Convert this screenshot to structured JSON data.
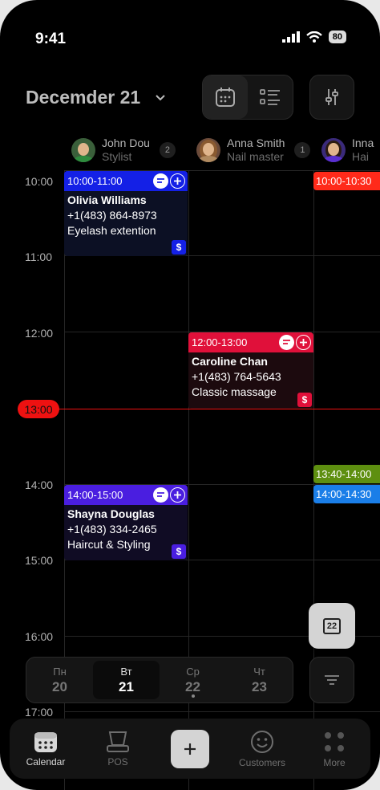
{
  "status": {
    "time": "9:41",
    "battery": "80"
  },
  "header": {
    "date": "Decemder 21"
  },
  "staff": [
    {
      "name": "John Dou",
      "role": "Stylist",
      "count": "2",
      "shirt": "#2e8b3e",
      "bg": "#3a5f3a"
    },
    {
      "name": "Anna Smith",
      "role": "Nail master",
      "count": "1",
      "shirt": "#b08a60",
      "bg": "#6a4a3a"
    },
    {
      "name": "Inna",
      "role": "Hai",
      "count": "",
      "shirt": "#5a2fd0",
      "bg": "#3a2a7a"
    }
  ],
  "hours": [
    "10:00",
    "11:00",
    "12:00",
    "14:00",
    "15:00",
    "16:00",
    "17:00"
  ],
  "now": "13:00",
  "appointments": [
    {
      "time": "10:00-11:00",
      "client": "Olivia Williams",
      "phone": "+1(483) 864-8973",
      "service": "Eyelash extention",
      "pay": "$",
      "accent": "#1420e6",
      "bg": "#0c1024"
    },
    {
      "time": "12:00-13:00",
      "client": "Caroline Chan",
      "phone": "+1(483) 764-5643",
      "service": "Classic massage",
      "pay": "$",
      "accent": "#e0103a",
      "bg": "#1c0a0e"
    },
    {
      "time": "14:00-15:00",
      "client": "Shayna Douglas",
      "phone": "+1(483) 334-2465",
      "service": "Haircut & Styling",
      "pay": "$",
      "accent": "#4a1ee0",
      "bg": "#100c24"
    }
  ],
  "side_appts": [
    {
      "time": "10:00-10:30",
      "bg": "#ff2a1a"
    },
    {
      "time": "13:40-14:00",
      "bg": "#5e8f10"
    },
    {
      "time": "14:00-14:30",
      "bg": "#1a7ee8"
    }
  ],
  "today_fab": "22",
  "week": [
    {
      "wd": "Пн",
      "dn": "20"
    },
    {
      "wd": "Вт",
      "dn": "21"
    },
    {
      "wd": "Ср",
      "dn": "22"
    },
    {
      "wd": "Чт",
      "dn": "23"
    }
  ],
  "tabs": {
    "calendar": "Calendar",
    "pos": "POS",
    "customers": "Customers",
    "more": "More"
  }
}
